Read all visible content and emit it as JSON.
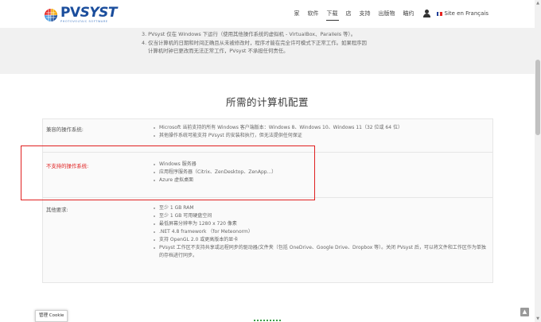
{
  "brand": {
    "name_pv": "PV",
    "name_syst": "SYST",
    "tagline": "PHOTOVOLTAIC SOFTWARE",
    "colors": [
      "#e52421",
      "#f6a800",
      "#1a4d9c",
      "#4a9be0"
    ]
  },
  "nav": {
    "items": [
      {
        "label": "家",
        "active": false
      },
      {
        "label": "软件",
        "active": false
      },
      {
        "label": "下载",
        "active": true
      },
      {
        "label": "店",
        "active": false
      },
      {
        "label": "支持",
        "active": false
      },
      {
        "label": "出版物",
        "active": false
      },
      {
        "label": "瞄约",
        "active": false
      }
    ],
    "user_icon": "user-icon",
    "language": "Site en Français",
    "flag_colors": [
      "#1f3f99",
      "#ffffff",
      "#e52421"
    ]
  },
  "notes": {
    "line1": "3. PVsyst 仅在 Windows 下运行（使用其他操作系统的虚拟机 - VirtualBox、Parallels 等）。",
    "line2": "4. 仅当计算机的日期和时间正确且从未被修改时，程序才能在完全许可模式下正常工作。如果程序因",
    "line3": "计算机时钟已更改而无法正常工作，PVsyst 不承担任何责任。"
  },
  "section_title": "所需的计算机配置",
  "table": {
    "rows": [
      {
        "label": "兼容的操作系统:",
        "highlight": false,
        "items": [
          "Microsoft 当前支持的所有 Windows 客户端版本：Windows 8、Windows 10、Windows 11（32 位或 64 位）",
          "其他操作系统可能支持 PVsyst 的安装和执行，但无法提供任何保证"
        ]
      },
      {
        "label": "不支持的操作系统:",
        "highlight": true,
        "items": [
          "Windows 服务器",
          "应用程序服务器（Citrix、ZenDesktop、ZenApp...）",
          "Azure 虚拟桌面"
        ]
      },
      {
        "label": "其他要求:",
        "highlight": false,
        "items": [
          "至少 1 GB RAM",
          "至少 1 GB 可用硬盘空间",
          "最低屏幕分辨率为 1280 x 720 像素",
          ".NET 4.8 framework （for Meteonorm）",
          "支持 OpenGL 2.0 或更高版本的显卡",
          "PVsyst 工作区不支持共享或远程同步的驱动器/文件夹（包括 OneDrive、Google Drive、Dropbox 等）。关闭 PVsyst 后，可以将文件和工作区作为单独的存档进行同步。"
        ]
      }
    ]
  },
  "cookie_button": "管理 Cookie",
  "scroll_top_icon": "chevron-up-icon",
  "annotation_color": "#e02020"
}
